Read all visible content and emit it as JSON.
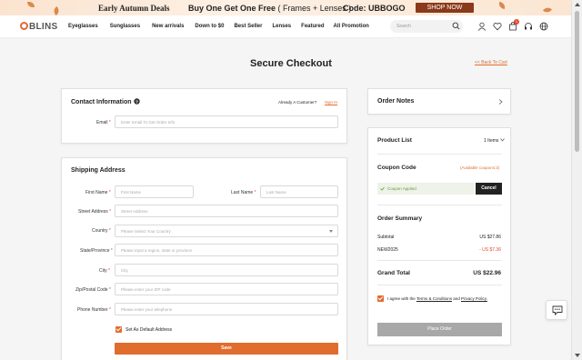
{
  "promo": {
    "deals": "Early Autumn Deals",
    "offer_main": "Buy One Get One Free",
    "offer_sub": " ( Frames + Lenses )",
    "code": "Code: UBBOGO",
    "shop_now": "SHOP NOW"
  },
  "nav": {
    "logo": "BLINS",
    "menu": [
      "Eyeglasses",
      "Sunglasses",
      "New arrivals",
      "Down to $0",
      "Best Seller",
      "Lenses",
      "Featured",
      "All Promotion"
    ],
    "search_placeholder": "Search",
    "cart_count": "1"
  },
  "page": {
    "title": "Secure Checkout",
    "back_link": "<< Back To Cart"
  },
  "contact": {
    "title": "Contact Information",
    "already_customer": "Already A Customer?",
    "sign_in": "Sign In",
    "email_label": "Email",
    "email_placeholder": "Enter Email To Get Order Info"
  },
  "shipping": {
    "title": "Shipping Address",
    "first_name_label": "First Name",
    "first_name_placeholder": "First Name",
    "last_name_label": "Last Name",
    "last_name_placeholder": "Last Name",
    "street_label": "Street Address",
    "street_placeholder": "Street Address",
    "country_label": "Country",
    "country_placeholder": "Please Select Your Country",
    "state_label": "State/Province",
    "state_placeholder": "Please input a region, state or province",
    "city_label": "City",
    "city_placeholder": "City",
    "zip_label": "Zip/Postal Code",
    "zip_placeholder": "Please enter your ZIP code",
    "phone_label": "Phone Number",
    "phone_placeholder": "Please enter your telephone",
    "default_address": "Set As Default Address",
    "save": "Save"
  },
  "order_notes": {
    "title": "Order Notes"
  },
  "summary": {
    "product_list": "Product List",
    "items": "1 Items",
    "coupon_code": "Coupon Code",
    "available_coupons": "(Available coupons:2)",
    "coupon_applied": "Coupon Applied",
    "cancel": "Cancel",
    "order_summary": "Order Summary",
    "subtotal_label": "Subtotal",
    "subtotal_value": "US $27.86",
    "discount_label": "NEW2025",
    "discount_value": "- US $7.36",
    "grand_total_label": "Grand Total",
    "grand_total_value": "US $22.96",
    "agree_prefix": "I agree with the ",
    "terms": "Terms & Conditions",
    "and": " and ",
    "privacy": "Privacy Policy.",
    "place_order": "Place Order"
  },
  "colors": {
    "accent": "#e06c2e",
    "promo_button": "#8a3a1a",
    "place_order_disabled": "#a8a8a8",
    "coupon_applied_bg": "#eef2e8",
    "discount": "#e04a2e"
  },
  "icons": [
    "search-icon",
    "user-icon",
    "heart-icon",
    "cart-icon",
    "headset-icon",
    "globe-icon",
    "help-icon",
    "chevron-right-icon",
    "chevron-down-icon",
    "check-icon",
    "chat-icon"
  ]
}
